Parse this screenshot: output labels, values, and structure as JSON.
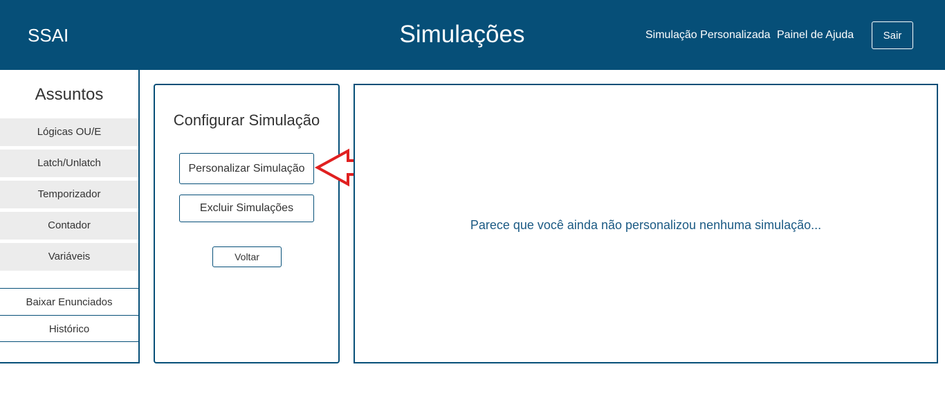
{
  "header": {
    "brand": "SSAI",
    "title": "Simulações",
    "nav": {
      "custom_simulation": "Simulação Personalizada",
      "help_panel": "Painel de Ajuda"
    },
    "logout_label": "Sair"
  },
  "sidebar": {
    "title": "Assuntos",
    "subjects": [
      "Lógicas OU/E",
      "Latch/Unlatch",
      "Temporizador",
      "Contador",
      "Variáveis"
    ],
    "links": [
      "Baixar Enunciados",
      "Histórico"
    ]
  },
  "config": {
    "title": "Configurar Simulação",
    "personalize_label": "Personalizar Simulação",
    "delete_label": "Excluir Simulações",
    "back_label": "Voltar"
  },
  "results": {
    "empty_message": "Parece que você ainda não personalizou nenhuma simulação..."
  },
  "colors": {
    "primary": "#064f78",
    "annotation_arrow": "#e02020",
    "item_background": "#ececec"
  }
}
